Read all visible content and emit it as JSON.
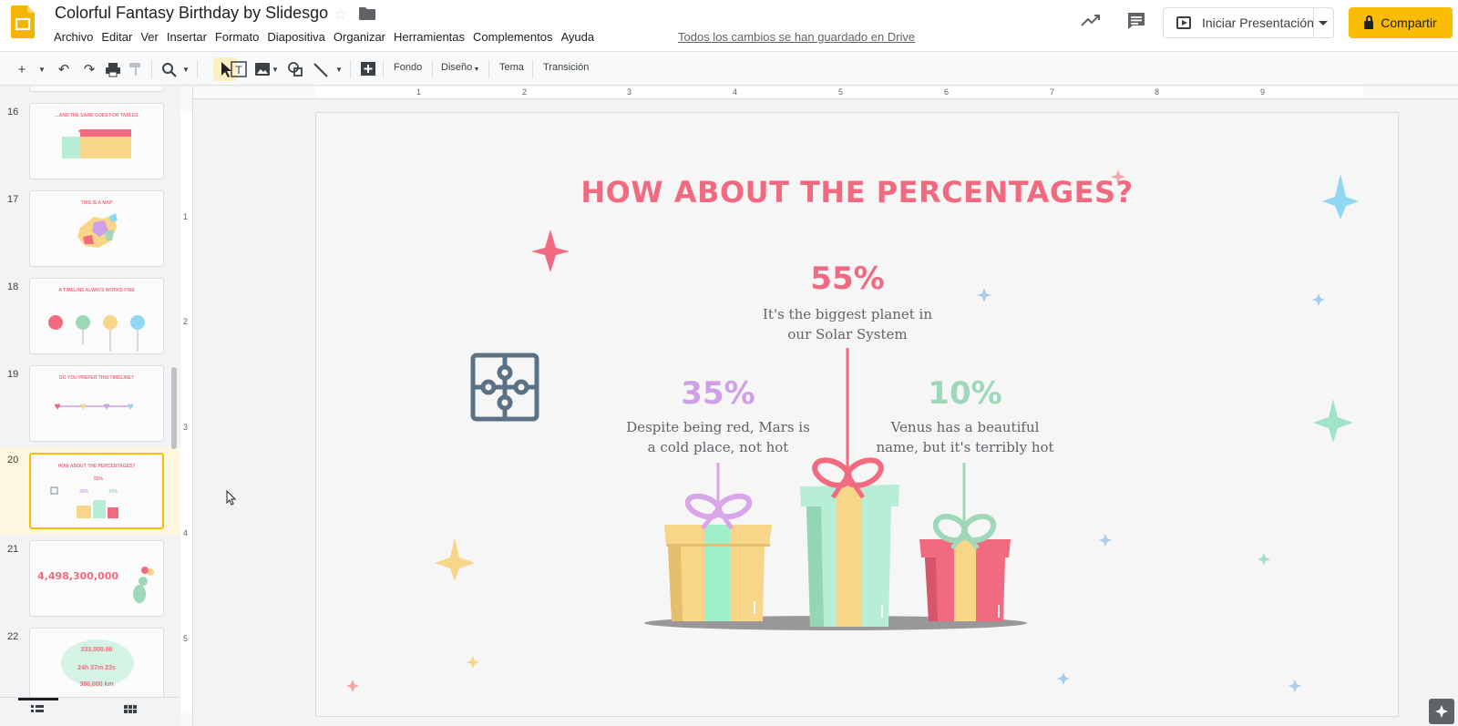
{
  "app": {
    "doc_title": "Colorful Fantasy Birthday by Slidesgo",
    "menu": [
      "Archivo",
      "Editar",
      "Ver",
      "Insertar",
      "Formato",
      "Diapositiva",
      "Organizar",
      "Herramientas",
      "Complementos",
      "Ayuda"
    ],
    "saved_status": "Todos los cambios se han guardado en Drive",
    "present_label": "Iniciar Presentación",
    "share_label": "Compartir"
  },
  "toolbar": {
    "fondo": "Fondo",
    "diseno": "Diseño",
    "tema": "Tema",
    "transicion": "Transición"
  },
  "filmstrip": {
    "slides": [
      {
        "num": "16",
        "title": "...AND THE SAME GOES FOR TABLES"
      },
      {
        "num": "17",
        "title": "THIS IS A MAP"
      },
      {
        "num": "18",
        "title": "A TIMELINE ALWAYS WORKS FINE"
      },
      {
        "num": "19",
        "title": "DO YOU PREFER THIS TIMELINE?"
      },
      {
        "num": "20",
        "title": "HOW ABOUT THE PERCENTAGES?"
      },
      {
        "num": "21",
        "title": "4,498,300,000"
      },
      {
        "num": "22",
        "title": "333,000.00"
      }
    ],
    "slide22_values": [
      "333,000.00",
      "24h 37m 23s",
      "386,000 km"
    ]
  },
  "rulers": {
    "top": [
      "1",
      "2",
      "3",
      "4",
      "5",
      "6",
      "7",
      "8",
      "9"
    ],
    "left": [
      "1",
      "2",
      "3",
      "4",
      "5"
    ]
  },
  "slide": {
    "title": "HOW ABOUT THE PERCENTAGES?",
    "items": [
      {
        "percent": "55%",
        "text_line1": "It's the biggest planet in",
        "text_line2": "our Solar System",
        "color": "#f26a80"
      },
      {
        "percent": "35%",
        "text_line1": "Despite being red, Mars is",
        "text_line2": "a cold place, not hot",
        "color": "#cfa0e8"
      },
      {
        "percent": "10%",
        "text_line1": "Venus has a beautiful",
        "text_line2": "name, but it's terribly hot",
        "color": "#9fd8b8"
      }
    ],
    "colors": {
      "pink": "#f26a80",
      "lilac": "#d9a6ea",
      "mint": "#b7efd6",
      "yellow": "#f7d68a",
      "blue": "#8ed8f2",
      "puzzle": "#5b7185"
    }
  }
}
